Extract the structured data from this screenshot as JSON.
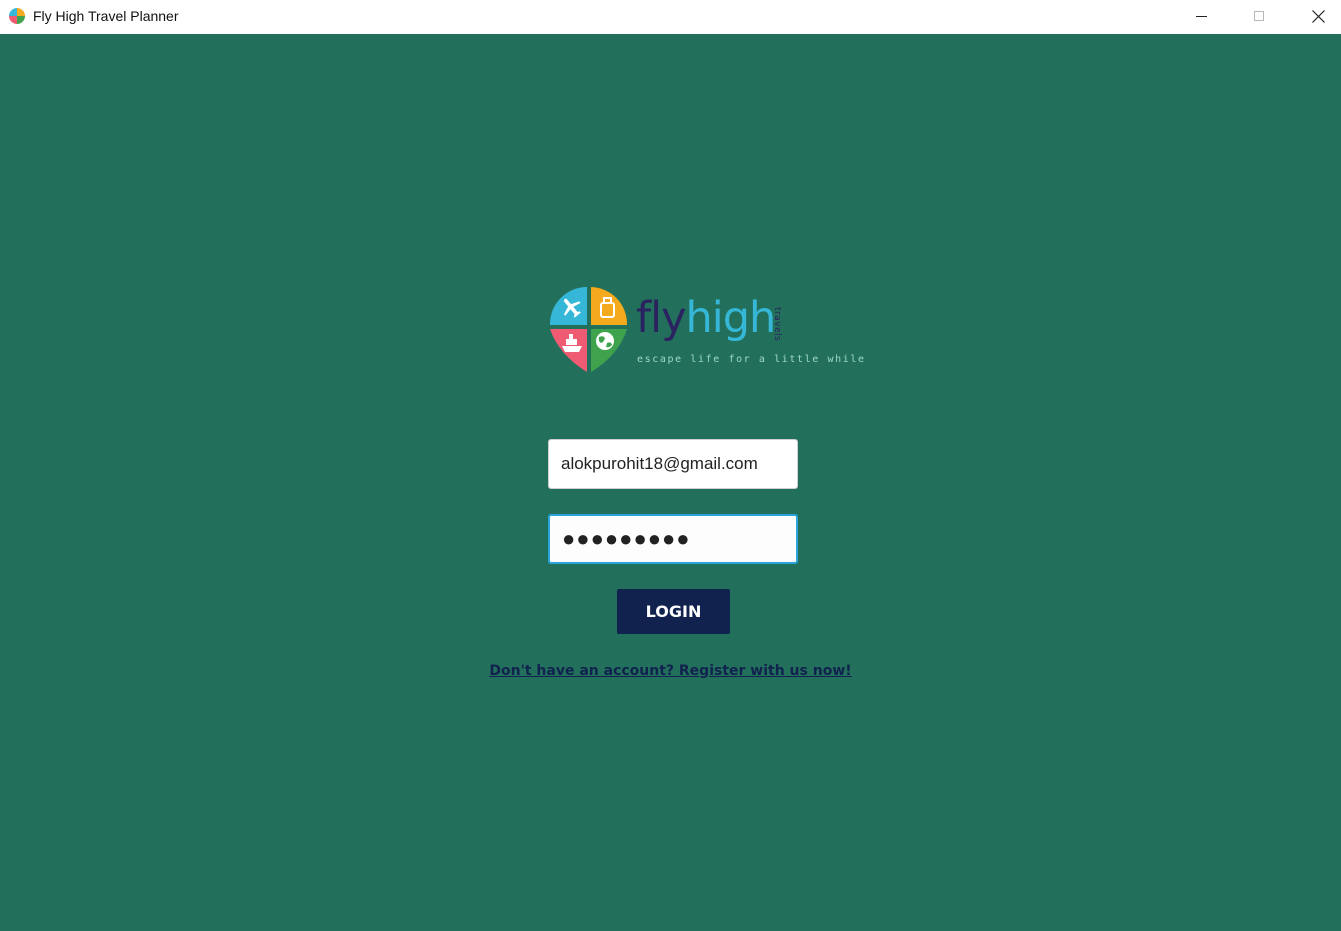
{
  "window": {
    "title": "Fly High Travel Planner",
    "controls": [
      "minimize",
      "maximize",
      "close"
    ]
  },
  "logo": {
    "word_fly": "fly",
    "word_high": "high",
    "side_text": "travels",
    "tagline": "escape life for a little while",
    "colors": {
      "fly": "#2b2360",
      "high": "#36b7d8",
      "quad_plane": "#36b7d8",
      "quad_bag": "#f5a91c",
      "quad_ship": "#ef5b73",
      "quad_globe": "#3fa34d"
    }
  },
  "form": {
    "email_value": "alokpurohit18@gmail.com",
    "password_value": "●●●●●●●●●",
    "login_label": "LOGIN",
    "register_link": "Don't have an account? Register with us now!"
  },
  "colors": {
    "background": "#22705c",
    "button": "#10224d",
    "focus_border": "#2aa4da"
  }
}
